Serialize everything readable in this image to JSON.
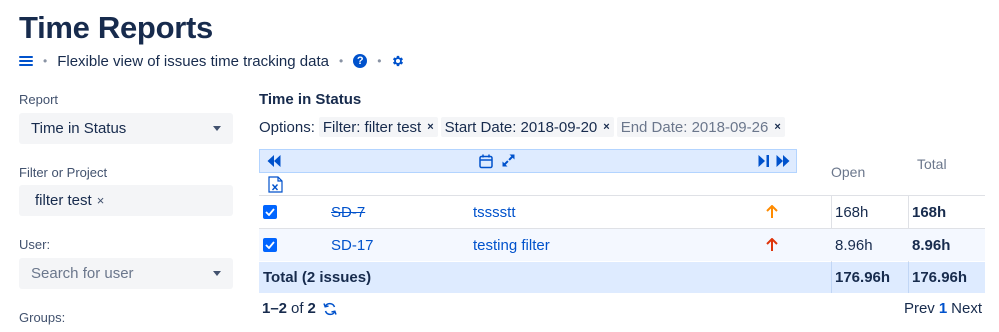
{
  "header": {
    "title": "Time Reports",
    "subtitle": "Flexible view of issues time tracking data",
    "help_glyph": "?"
  },
  "sidebar": {
    "report_label": "Report",
    "report_value": "Time in Status",
    "filter_label": "Filter or Project",
    "filter_tag": "filter test",
    "filter_tag_remove": "×",
    "user_label": "User:",
    "user_placeholder": "Search for user",
    "groups_label": "Groups:"
  },
  "main": {
    "title": "Time in Status",
    "options_label": "Options:",
    "chips": [
      {
        "label": "Filter: filter test",
        "remove": "×"
      },
      {
        "label": "Start Date: 2018-09-20",
        "remove": "×"
      },
      {
        "label": "End Date: 2018-09-26",
        "remove": "×"
      }
    ],
    "columns": {
      "open": "Open",
      "total": "Total"
    },
    "rows": [
      {
        "checked": true,
        "key": "SD-7",
        "resolved": true,
        "summary": "tsssstt",
        "priority": "high",
        "priority_color": "#ff8b00",
        "open": "168h",
        "total": "168h"
      },
      {
        "checked": true,
        "key": "SD-17",
        "resolved": false,
        "summary": "testing filter",
        "priority": "highest",
        "priority_color": "#de350b",
        "open": "8.96h",
        "total": "8.96h"
      }
    ],
    "totals": {
      "label": "Total (2 issues)",
      "open": "176.96h",
      "total": "176.96h"
    },
    "pager": {
      "range": "1–2",
      "of": "of",
      "count": "2",
      "prev": "Prev",
      "page": "1",
      "next": "Next"
    }
  },
  "colors": {
    "accent": "#0052cc",
    "nav_bg": "#deebff",
    "checkbox": "#0065ff"
  }
}
